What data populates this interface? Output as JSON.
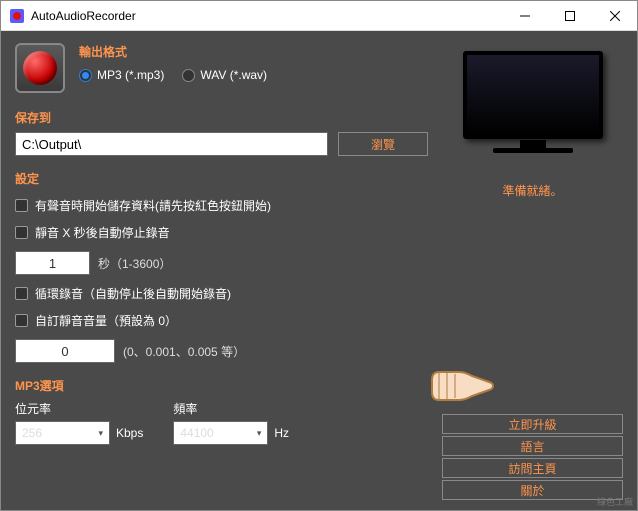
{
  "window": {
    "title": "AutoAudioRecorder"
  },
  "format": {
    "section": "輸出格式",
    "mp3": "MP3 (*.mp3)",
    "wav": "WAV (*.wav)"
  },
  "save": {
    "section": "保存到",
    "path": "C:\\Output\\",
    "browse": "瀏覽"
  },
  "settings": {
    "section": "設定",
    "autoStart": "有聲音時開始儲存資料(請先按紅色按鈕開始)",
    "autoStop": "靜音 X 秒後自動停止錄音",
    "autoStopValue": "1",
    "autoStopUnit": "秒（1-3600）",
    "loop": "循環錄音（自動停止後自動開始錄音)",
    "customVol": "自訂靜音音量（預設為 0）",
    "customVolValue": "0",
    "customVolHint": "(0、0.001、0.005 等）"
  },
  "mp3": {
    "section": "MP3選項",
    "bitrate_label": "位元率",
    "bitrate_value": "256",
    "bitrate_unit": "Kbps",
    "freq_label": "頻率",
    "freq_value": "44100",
    "freq_unit": "Hz"
  },
  "right": {
    "status": "準備就緒。",
    "upgrade": "立即升級",
    "language": "語言",
    "homepage": "訪問主頁",
    "about": "關於"
  },
  "watermark": "綠色工廠"
}
